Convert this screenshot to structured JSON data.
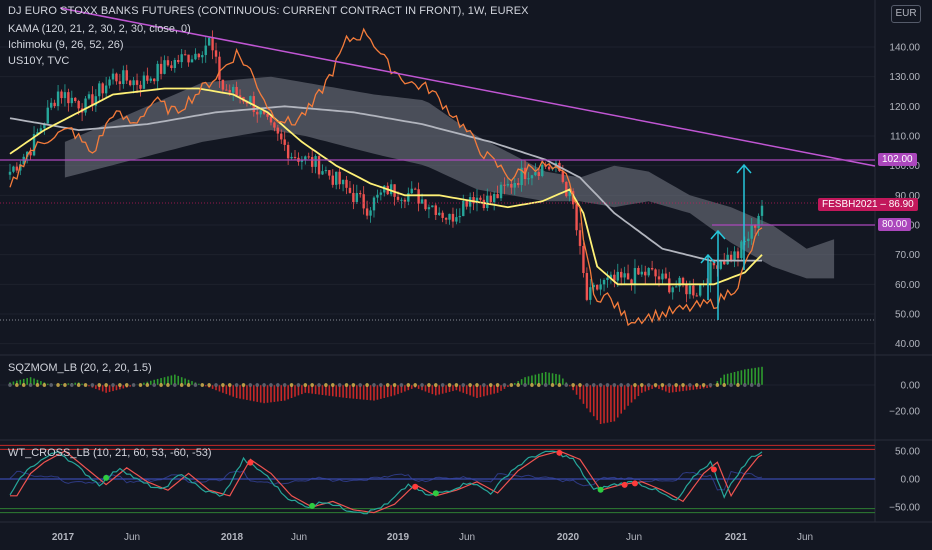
{
  "legend": {
    "title": "DJ EURO STOXX BANKS FUTURES (CONTINUOUS: CURRENT CONTRACT IN FRONT), 1W, EUREX",
    "kama": "KAMA (120, 21, 2, 30, 2, 30, close, 0)",
    "ichimoku": "Ichimoku (9, 26, 52, 26)",
    "us10y": "US10Y, TVC",
    "sqz": "SQZMOM_LB (20, 2, 20, 1.5)",
    "wt": "WT_CROSS_LB (10, 21, 60, 53, -60, -53)"
  },
  "currency_button": "EUR",
  "badges": {
    "level_102": "102.00",
    "symbol_price": "FESBH2021 – 86.90",
    "level_80": "80.00"
  },
  "colors": {
    "background": "#131722",
    "up_candle": "#26a69a",
    "down_candle": "#ef5350",
    "kama": "#fff176",
    "slow_ma": "#b2b5be",
    "us10y": "#f57c3b",
    "trendline": "#c056d3",
    "level": "#ab47bc",
    "arrow": "#26c6da",
    "sqz_pos": "#2e9c2e",
    "sqz_neg": "#c62828",
    "wt_fast": "#26a69a",
    "wt_slow": "#ef5350"
  },
  "chart_data": [
    {
      "type": "line",
      "title": "DJ EURO STOXX BANKS FUTURES (CONTINUOUS: CURRENT CONTRACT IN FRONT), 1W, EUREX",
      "x_ticks": [
        "2017",
        "Jun",
        "2018",
        "Jun",
        "2019",
        "Jun",
        "2020",
        "Jun",
        "2021",
        "Jun"
      ],
      "y_ticks": [
        40,
        50,
        60,
        70,
        80,
        90,
        100,
        110,
        120,
        130,
        140
      ],
      "ylim": [
        40,
        148
      ],
      "series": [
        {
          "name": "FESBH2021",
          "x": [
            "2016-12",
            "2017-03",
            "2017-06",
            "2017-09",
            "2017-12",
            "2018-03",
            "2018-06",
            "2018-09",
            "2018-12",
            "2019-03",
            "2019-06",
            "2019-09",
            "2019-12",
            "2020-02",
            "2020-04",
            "2020-06",
            "2020-09",
            "2020-11",
            "2021-01",
            "2021-02"
          ],
          "values": [
            98,
            125,
            130,
            135,
            138,
            125,
            105,
            98,
            88,
            92,
            80,
            88,
            98,
            100,
            52,
            65,
            55,
            68,
            75,
            86.9
          ]
        },
        {
          "name": "KAMA",
          "values": [
            110,
            118,
            120,
            122,
            123,
            122,
            110,
            96,
            88,
            86,
            86,
            88,
            90,
            92,
            62,
            60,
            60,
            62,
            65,
            70
          ]
        },
        {
          "name": "US10Y",
          "values": [
            95,
            105,
            120,
            128,
            140,
            128,
            120,
            118,
            145,
            130,
            118,
            100,
            98,
            100,
            50,
            45,
            48,
            52,
            65,
            80
          ]
        }
      ],
      "levels": [
        102,
        80
      ],
      "last_price": 86.9
    },
    {
      "type": "bar",
      "title": "SQZMOM_LB (20, 2, 20, 1.5)",
      "y_ticks": [
        "0.00",
        "−20.00"
      ],
      "ylim": [
        -35,
        15
      ]
    },
    {
      "type": "line",
      "title": "WT_CROSS_LB (10, 21, 60, 53, -60, -53)",
      "y_ticks": [
        "50.00",
        "0.00",
        "−50.00"
      ],
      "ylim": [
        -65,
        65
      ]
    }
  ]
}
